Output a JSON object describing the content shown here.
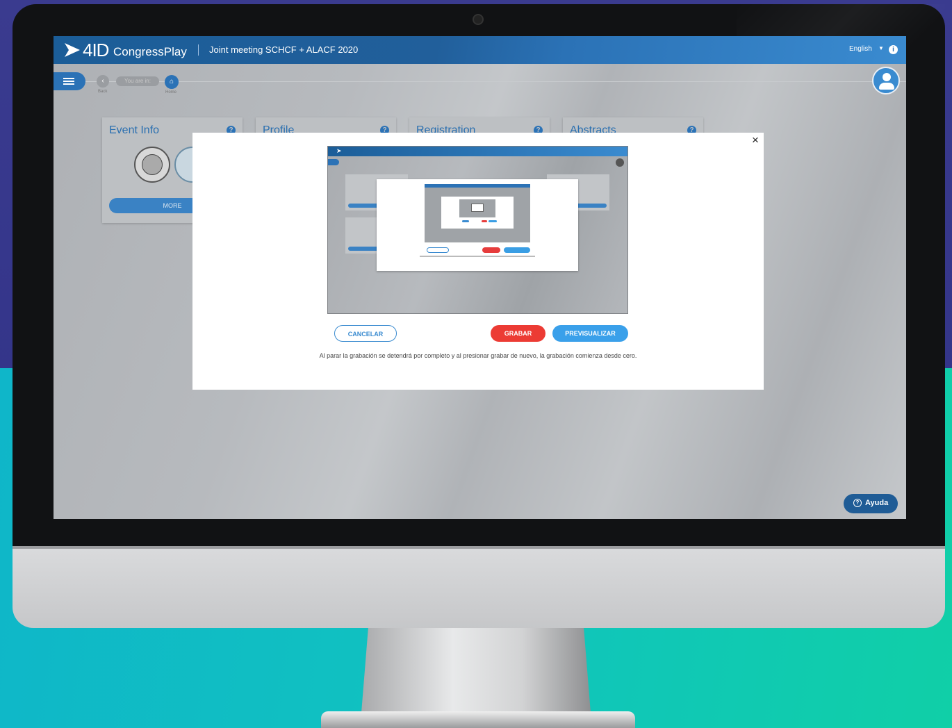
{
  "app": {
    "logo_mark": "4ID",
    "logo_name": "CongressPlay",
    "event_title": "Joint meeting SCHCF + ALACF 2020",
    "language": "English",
    "info_icon": "info-icon"
  },
  "breadcrumb": {
    "you_are_in": "You are in:",
    "back_label": "Back",
    "home_label": "Home"
  },
  "cards": [
    {
      "title": "Event Info",
      "button": "MORE"
    },
    {
      "title": "Profile"
    },
    {
      "title": "Registration"
    },
    {
      "title": "Abstracts"
    }
  ],
  "help_glyph": "?",
  "ayuda_label": "Ayuda",
  "modal": {
    "close_glyph": "×",
    "cancel_label": "CANCELAR",
    "record_label": "GRABAR",
    "preview_label": "PREVISUALIZAR",
    "note": "Al parar la grabación se detendrá por completo y al presionar grabar de nuevo, la grabación comienza desde cero."
  },
  "colors": {
    "brand_blue": "#2b72b6",
    "record_red": "#ec3b34",
    "preview_blue": "#3aa0ea"
  }
}
